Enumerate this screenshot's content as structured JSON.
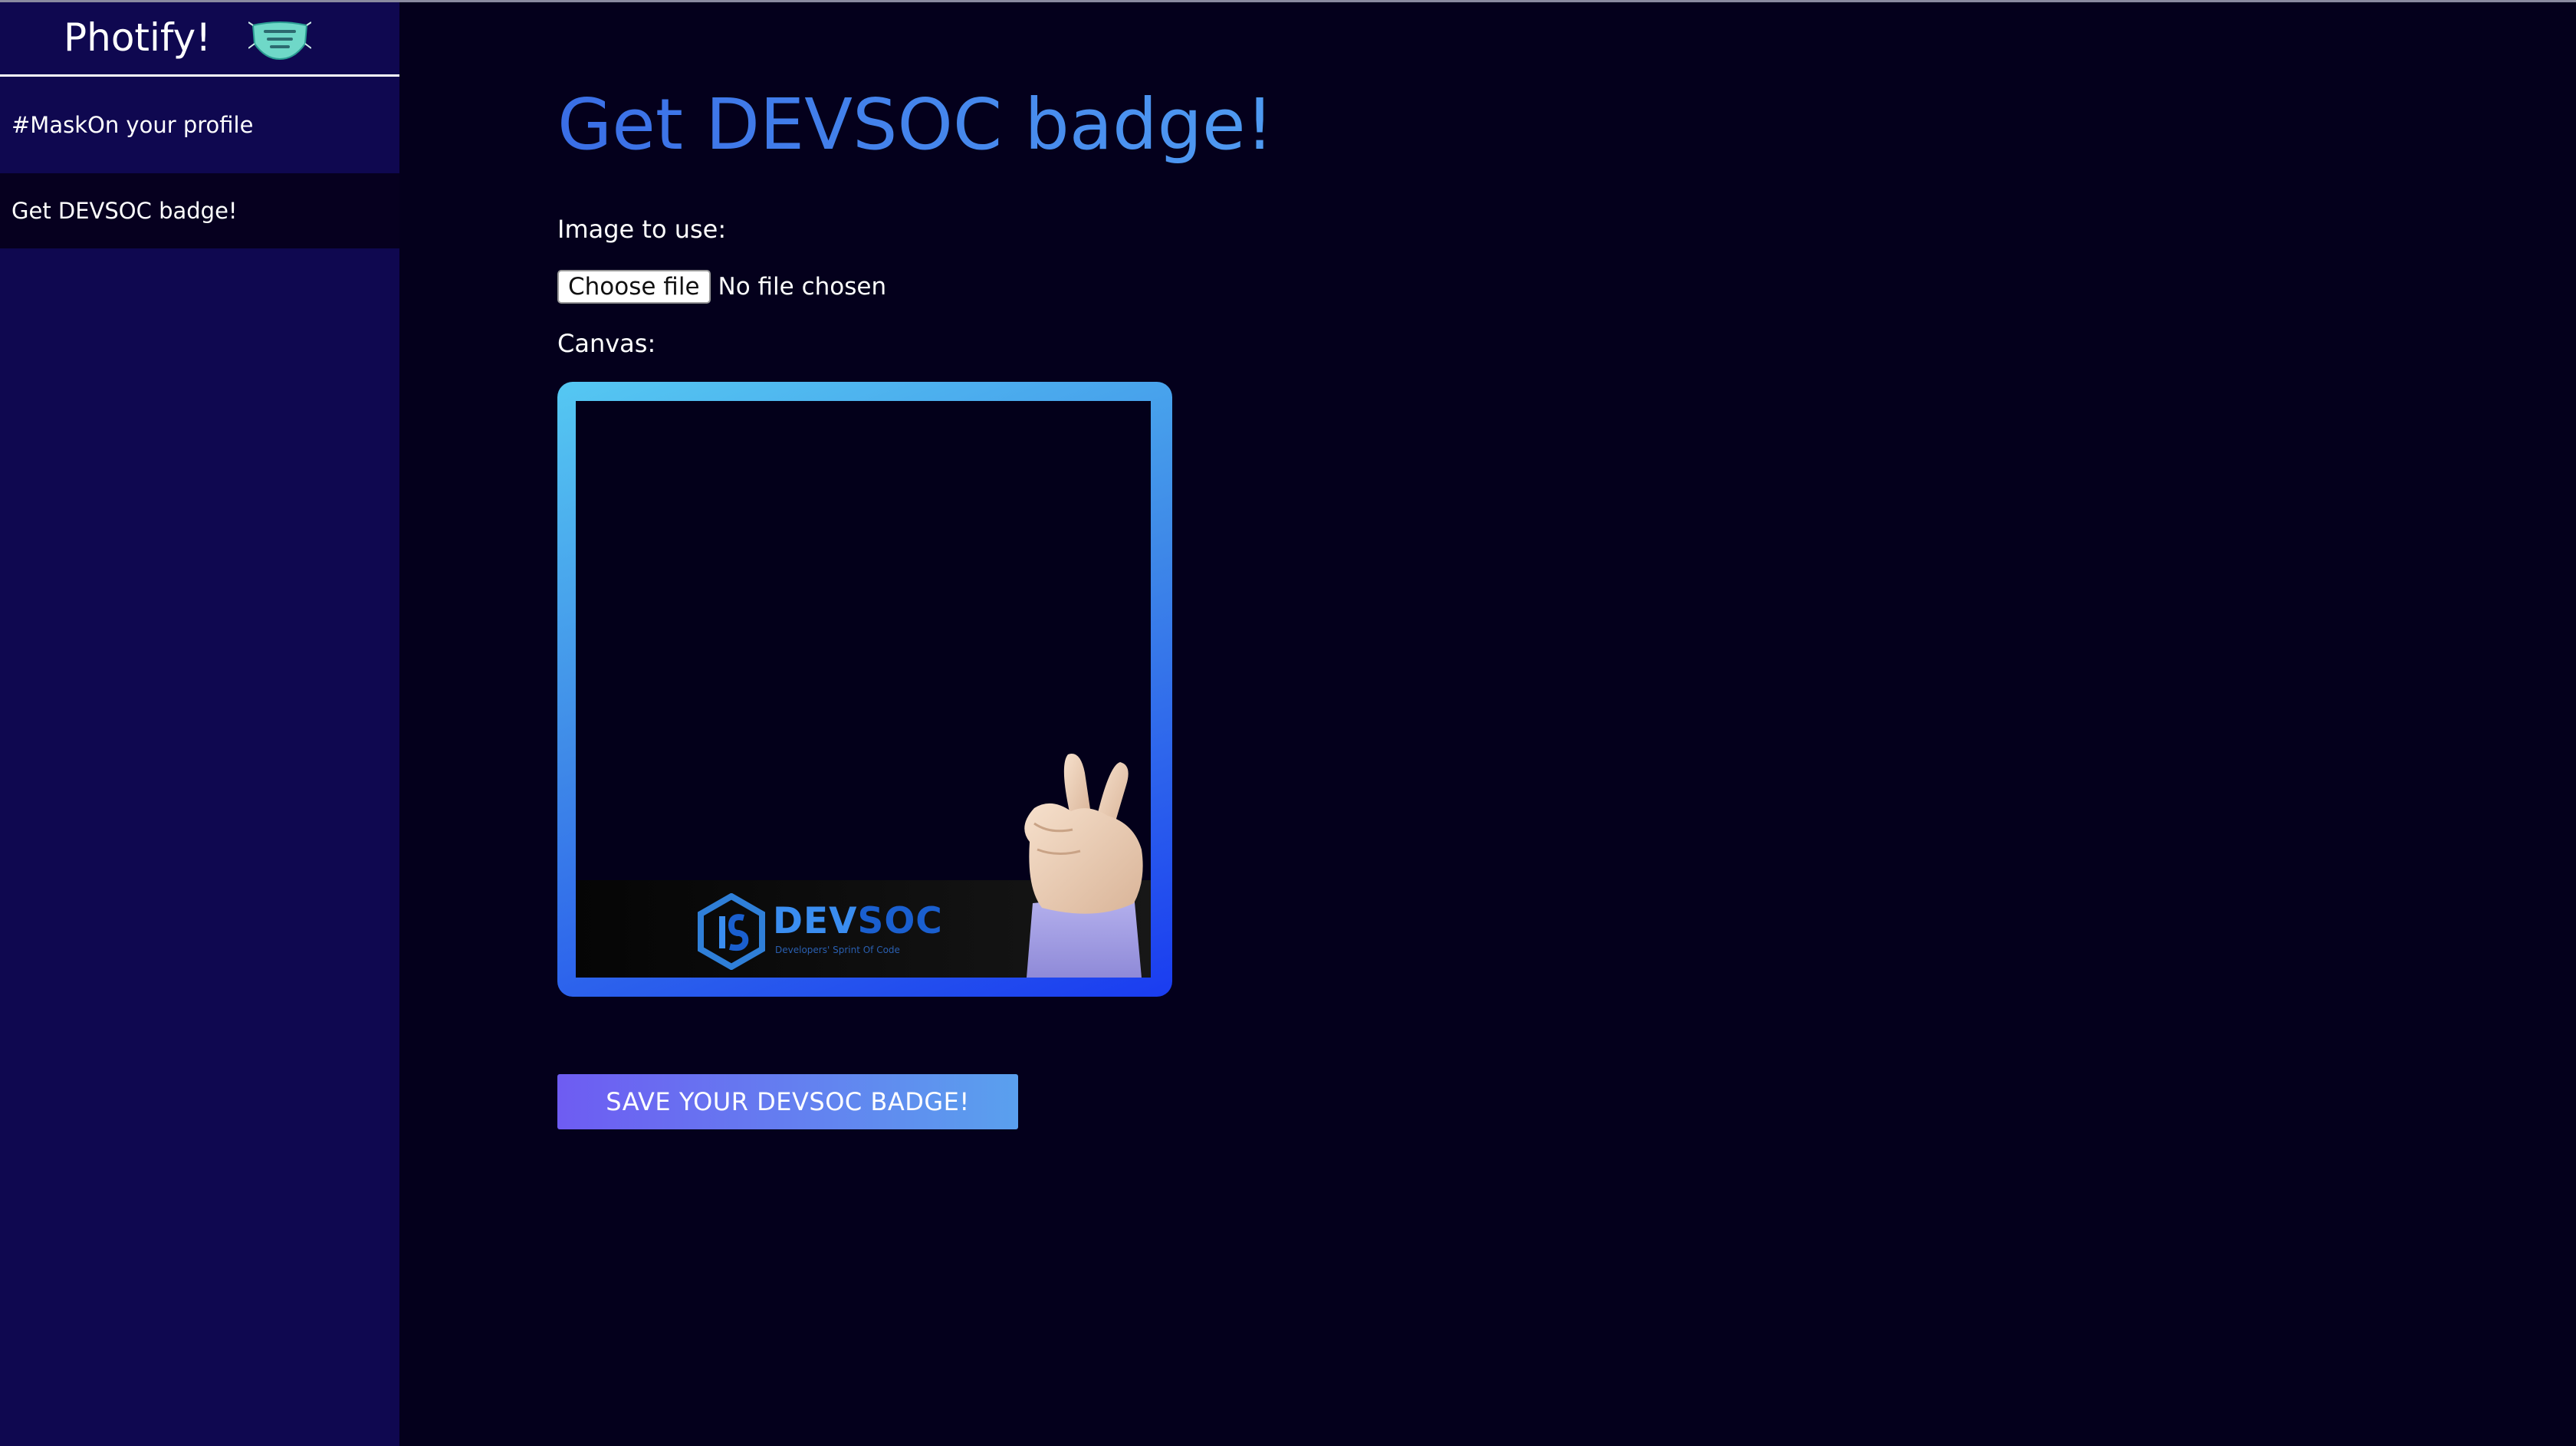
{
  "sidebar": {
    "brand_title": "Photify!",
    "items": [
      {
        "label": "#MaskOn your profile",
        "active": false
      },
      {
        "label": "Get DEVSOC badge!",
        "active": true
      }
    ]
  },
  "main": {
    "title": "Get DEVSOC badge!",
    "image_label": "Image to use:",
    "file_input": {
      "button_label": "Choose file",
      "status": "No file chosen"
    },
    "canvas_label": "Canvas:",
    "save_button_label": "SAVE YOUR DEVSOC BADGE!"
  },
  "badge": {
    "brand_part1": "DEV",
    "brand_part2": "SOC",
    "tagline": "Developers' Sprint Of Code"
  },
  "icons": {
    "brand_logo": "mask-icon",
    "canvas_overlay": "peace-hand-icon",
    "badge_logo": "devsoc-hexagon-icon"
  },
  "colors": {
    "background": "#04001c",
    "sidebar": "#0f0850",
    "sidebar_active": "#06001f",
    "title_gradient_start": "#3a6ee6",
    "title_gradient_end": "#4f9bf2",
    "frame_gradient_start": "#55c8f2",
    "frame_gradient_end": "#1a3cf0",
    "button_gradient_start": "#6e5cf2",
    "button_gradient_end": "#5aa0ee"
  }
}
